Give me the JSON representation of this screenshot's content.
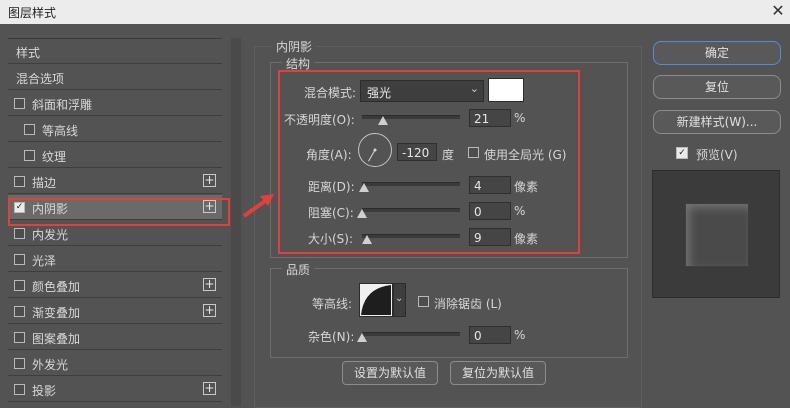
{
  "window": {
    "title": "图层样式",
    "close_icon": "close-icon"
  },
  "sidebar": {
    "items": [
      {
        "label": "样式",
        "has_checkbox": false,
        "checked": false,
        "has_plus": false,
        "indent": false
      },
      {
        "label": "混合选项",
        "has_checkbox": false,
        "checked": false,
        "has_plus": false,
        "indent": false
      },
      {
        "label": "斜面和浮雕",
        "has_checkbox": true,
        "checked": false,
        "has_plus": false,
        "indent": false
      },
      {
        "label": "等高线",
        "has_checkbox": true,
        "checked": false,
        "has_plus": false,
        "indent": true
      },
      {
        "label": "纹理",
        "has_checkbox": true,
        "checked": false,
        "has_plus": false,
        "indent": true
      },
      {
        "label": "描边",
        "has_checkbox": true,
        "checked": false,
        "has_plus": true,
        "indent": false
      },
      {
        "label": "内阴影",
        "has_checkbox": true,
        "checked": true,
        "has_plus": true,
        "indent": false,
        "selected": true
      },
      {
        "label": "内发光",
        "has_checkbox": true,
        "checked": false,
        "has_plus": false,
        "indent": false
      },
      {
        "label": "光泽",
        "has_checkbox": true,
        "checked": false,
        "has_plus": false,
        "indent": false
      },
      {
        "label": "颜色叠加",
        "has_checkbox": true,
        "checked": false,
        "has_plus": true,
        "indent": false
      },
      {
        "label": "渐变叠加",
        "has_checkbox": true,
        "checked": false,
        "has_plus": true,
        "indent": false
      },
      {
        "label": "图案叠加",
        "has_checkbox": true,
        "checked": false,
        "has_plus": false,
        "indent": false
      },
      {
        "label": "外发光",
        "has_checkbox": true,
        "checked": false,
        "has_plus": false,
        "indent": false
      },
      {
        "label": "投影",
        "has_checkbox": true,
        "checked": false,
        "has_plus": true,
        "indent": false
      }
    ]
  },
  "inner_shadow": {
    "section_title": "内阴影",
    "structure": {
      "title": "结构",
      "blend_mode_label": "混合模式:",
      "blend_mode_value": "强光",
      "shadow_color": "#ffffff",
      "opacity_label": "不透明度(O):",
      "opacity_value": "21",
      "opacity_unit": "%",
      "opacity_pct": 21,
      "angle_label": "角度(A):",
      "angle_value": "-120",
      "angle_unit": "度",
      "angle_deg": -120,
      "global_light_label": "使用全局光 (G)",
      "global_light_checked": false,
      "distance_label": "距离(D):",
      "distance_value": "4",
      "distance_unit": "像素",
      "distance_pct": 2,
      "choke_label": "阻塞(C):",
      "choke_value": "0",
      "choke_unit": "%",
      "choke_pct": 0,
      "size_label": "大小(S):",
      "size_value": "9",
      "size_unit": "像素",
      "size_pct": 5
    },
    "quality": {
      "title": "品质",
      "contour_label": "等高线:",
      "anti_alias_label": "消除锯齿 (L)",
      "anti_alias_checked": false,
      "noise_label": "杂色(N):",
      "noise_value": "0",
      "noise_unit": "%",
      "noise_pct": 0
    },
    "set_default_label": "设置为默认值",
    "reset_default_label": "复位为默认值"
  },
  "actions": {
    "ok_label": "确定",
    "reset_label": "复位",
    "new_style_label": "新建样式(W)...",
    "preview_label": "预览(V)",
    "preview_checked": true
  },
  "annotation": {
    "highlight_color": "#e2403a"
  }
}
